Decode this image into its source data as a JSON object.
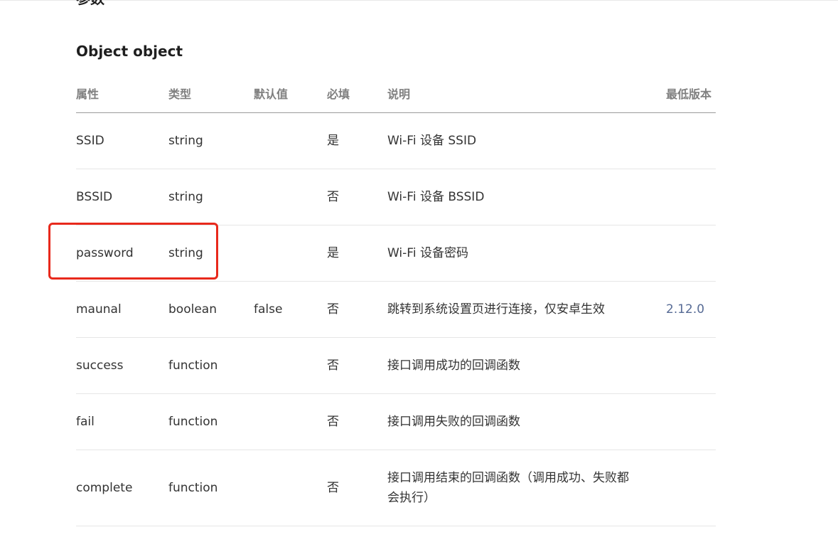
{
  "section": {
    "heading": "参数"
  },
  "object_title": "Object object",
  "table": {
    "headers": [
      "属性",
      "类型",
      "默认值",
      "必填",
      "说明",
      "最低版本"
    ],
    "rows": [
      {
        "name": "SSID",
        "type": "string",
        "default": "",
        "required": "是",
        "desc": "Wi-Fi 设备 SSID",
        "version": ""
      },
      {
        "name": "BSSID",
        "type": "string",
        "default": "",
        "required": "否",
        "desc": "Wi-Fi 设备 BSSID",
        "version": ""
      },
      {
        "name": "password",
        "type": "string",
        "default": "",
        "required": "是",
        "desc": "Wi-Fi 设备密码",
        "version": ""
      },
      {
        "name": "maunal",
        "type": "boolean",
        "default": "false",
        "required": "否",
        "desc": "跳转到系统设置页进行连接，仅安卓生效",
        "version": "2.12.0"
      },
      {
        "name": "success",
        "type": "function",
        "default": "",
        "required": "否",
        "desc": "接口调用成功的回调函数",
        "version": ""
      },
      {
        "name": "fail",
        "type": "function",
        "default": "",
        "required": "否",
        "desc": "接口调用失败的回调函数",
        "version": ""
      },
      {
        "name": "complete",
        "type": "function",
        "default": "",
        "required": "否",
        "desc": "接口调用结束的回调函数（调用成功、失败都会执行）",
        "version": ""
      }
    ]
  },
  "colors": {
    "annotation_box": "#e8291c",
    "version_link": "#576b95"
  }
}
